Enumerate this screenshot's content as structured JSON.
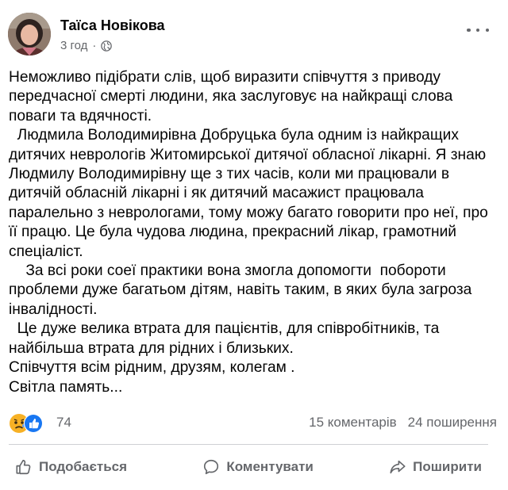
{
  "post": {
    "author": "Таїса Новікова",
    "time": "3 год",
    "separator": "·",
    "paragraphs": [
      "Неможливо підібрати слів, щоб виразити співчуття з приводу передчасної смерті людини, яка заслуговує на найкращі слова поваги та вдячності.",
      "  Людмила Володимирівна Добруцька була одним із найкращих дитячих неврологів Житомирської дитячої обласної лікарні. Я знаю Людмилу Володимирівну ще з тих часів, коли ми працювали в дитячій обласній лікарні і як дитячий масажист працювала паралельно з неврологами, тому можу багато говорити про неї, про її працю. Це була чудова людина, прекрасний лікар, грамотний спеціаліст.",
      "    За всі роки соеї практики вона змогла допомогти  побороти проблеми дуже багатьом дітям, навіть таким, в яких була загроза інвалідності.",
      "  Це дуже велика втрата для пацієнтів, для співробітників, та найбільша втрата для рідних і близьких.",
      "Співчуття всім рідним, друзям, колегам .",
      "Світла память..."
    ]
  },
  "reactions": {
    "count": "74",
    "comments": "15 коментарів",
    "shares": "24 поширення"
  },
  "actions": {
    "like": "Подобається",
    "comment": "Коментувати",
    "share": "Поширити"
  },
  "colors": {
    "secondary_text": "#65676b",
    "like_blue": "#1877f2",
    "sad_yellow": "#f7b125"
  }
}
